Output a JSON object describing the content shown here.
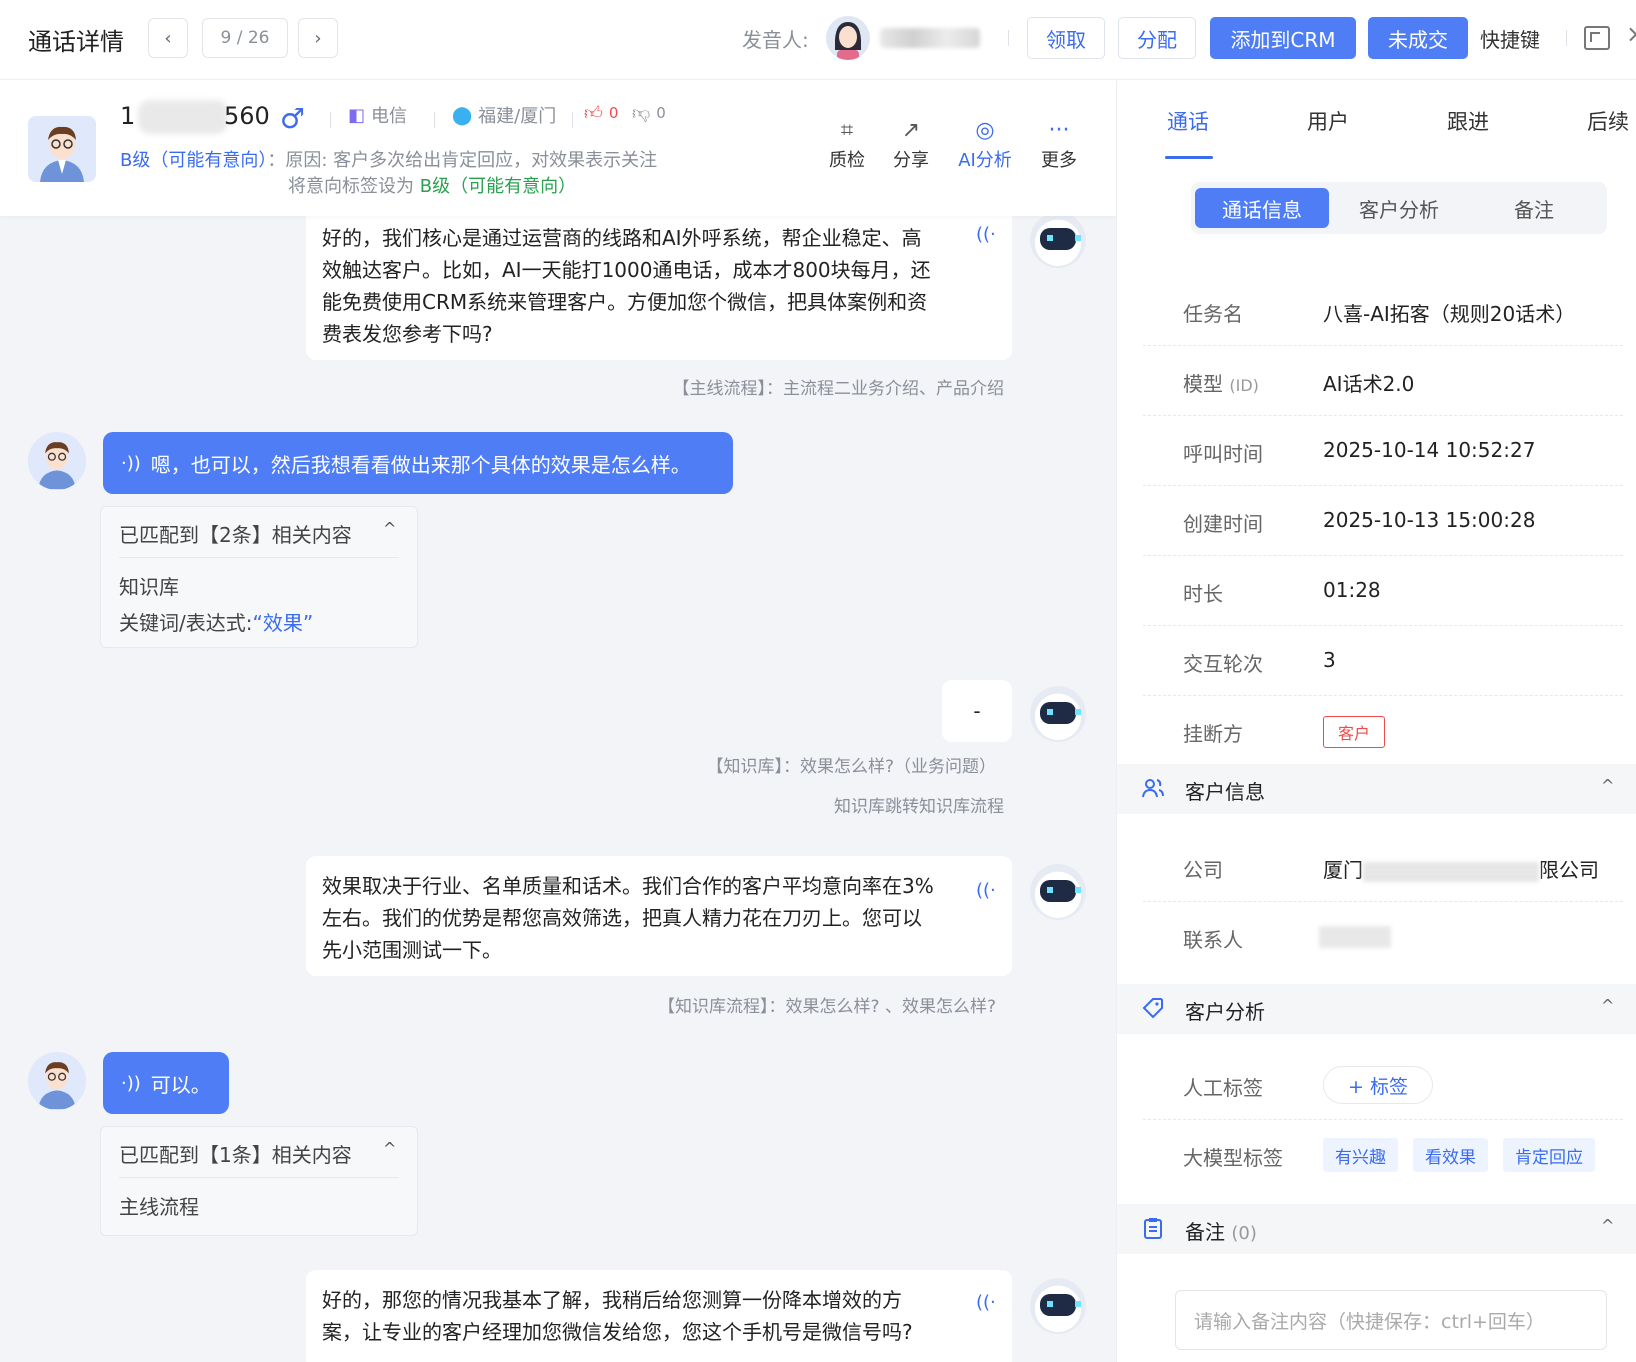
{
  "header": {
    "title": "通话详情",
    "pager": "9 / 26",
    "prev_icon": "‹",
    "next_icon": "›",
    "speaker_label": "发音人:",
    "buttons": {
      "claim": "领取",
      "assign": "分配",
      "add_crm": "添加到CRM",
      "not_closed": "未成交"
    },
    "shortcut": "快捷键",
    "close_glyph": "×"
  },
  "customer": {
    "phone_prefix": "1",
    "phone_suffix": "560",
    "gender_icon": "♂",
    "carrier": "电信",
    "region": "福建/厦门",
    "likes": "0",
    "dislikes": "0",
    "intent_level": "B级（可能有意向）",
    "intent_reason": "：原因: 客户多次给出肯定回应，对效果表示关注",
    "intent_set_prefix": "将意向标签设为",
    "intent_set_level": "B级（可能有意向）"
  },
  "tools": [
    {
      "label": "质检",
      "icon": "⌗"
    },
    {
      "label": "分享",
      "icon": "↗"
    },
    {
      "label": "AI分析",
      "icon": "◎"
    },
    {
      "label": "更多",
      "icon": "···"
    }
  ],
  "chat": {
    "msg1": [
      "好的，我们核心是通过运营商的线路和AI外呼系统，帮企业稳定、高",
      "效触达客户。比如，AI一天能打1000通电话，成本才800块每月，还",
      "能免费使用CRM系统来管理客户。方便加您个微信，把具体案例和资",
      "费表发您参考下吗?"
    ],
    "note1": "【主线流程】：主流程二业务介绍、产品介绍",
    "user1": "嗯，也可以，然后我想看看做出来那个具体的效果是怎么样。",
    "match1": {
      "title": "已匹配到【2条】相关内容",
      "item1": "知识库",
      "kw_label": "关键词/表达式:",
      "kw_value": "“效果”"
    },
    "msg2": "-",
    "note2": "【知识库】：效果怎么样?（业务问题）",
    "note3": "知识库跳转知识库流程",
    "msg3": [
      "效果取决于行业、名单质量和话术。我们合作的客户平均意向率在3%",
      "左右。我们的优势是帮您高效筛选，把真人精力花在刀刃上。您可以",
      "先小范围测试一下。"
    ],
    "note4": "【知识库流程】：效果怎么样? 、效果怎么样?",
    "user2": "可以。",
    "match2": {
      "title": "已匹配到【1条】相关内容",
      "item1": "主线流程"
    },
    "msg4": [
      "好的，那您的情况我基本了解，我稍后给您测算一份降本增效的方",
      "案，让专业的客户经理加您微信发给您，您这个手机号是微信号吗?"
    ],
    "wave_icon": "·))",
    "play_icon": "((·"
  },
  "right": {
    "tabs": [
      "通话",
      "用户",
      "跟进",
      "后续"
    ],
    "segments": [
      "通话信息",
      "客户分析",
      "备注"
    ],
    "info": [
      {
        "k": "任务名",
        "v": "八喜-AI拓客（规则20话术）"
      },
      {
        "k": "模型",
        "k_sub": "(ID)",
        "v": "AI话术2.0"
      },
      {
        "k": "呼叫时间",
        "v": "2025-10-14 10:52:27"
      },
      {
        "k": "创建时间",
        "v": "2025-10-13 15:00:28"
      },
      {
        "k": "时长",
        "v": "01:28"
      },
      {
        "k": "交互轮次",
        "v": "3"
      },
      {
        "k": "挂断方",
        "badge": "客户"
      }
    ],
    "customer_info": {
      "title": "客户信息",
      "company_label": "公司",
      "company_a": "厦门",
      "company_b": "限公司",
      "contact_label": "联系人"
    },
    "customer_analysis": {
      "title": "客户分析",
      "manual_label": "人工标签",
      "add_tag": "+ 标签",
      "llm_label": "大模型标签",
      "llm_tags": [
        "有兴趣",
        "看效果",
        "肯定回应"
      ]
    },
    "notes": {
      "title": "备注",
      "count": "(0)",
      "placeholder": "请输入备注内容（快捷保存：ctrl+回车）"
    }
  }
}
